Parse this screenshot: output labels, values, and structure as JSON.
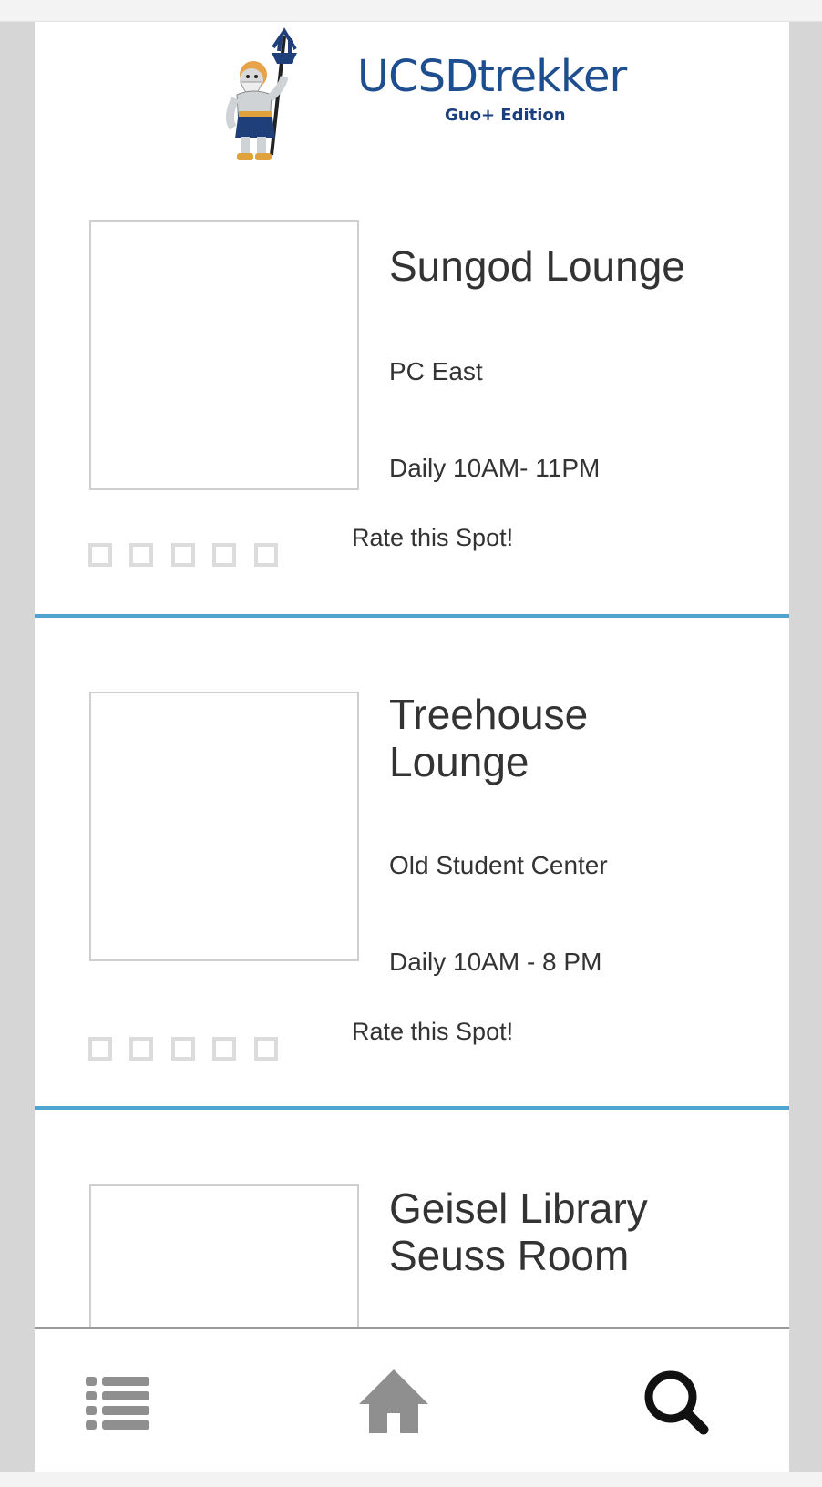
{
  "header": {
    "logo_title": "UCSDtrekker",
    "logo_subtitle": "Guo+ Edition",
    "brand_color": "#1f4e8f",
    "accent_color": "#4ea3cf"
  },
  "spots": [
    {
      "title": "Sungod Lounge",
      "location": "PC East",
      "hours": "Daily 10AM- 11PM",
      "rate_label": "Rate this Spot!",
      "rating": 0,
      "max_rating": 5
    },
    {
      "title": "Treehouse Lounge",
      "location": "Old Student Center",
      "hours": "Daily 10AM - 8 PM",
      "rate_label": "Rate this Spot!",
      "rating": 0,
      "max_rating": 5
    },
    {
      "title": "Geisel Library Seuss Room",
      "location": "",
      "hours": "",
      "rate_label": "",
      "rating": 0,
      "max_rating": 5
    }
  ],
  "bottom_nav": {
    "items": [
      {
        "icon": "list-icon",
        "active": false
      },
      {
        "icon": "home-icon",
        "active": false
      },
      {
        "icon": "search-icon",
        "active": true
      }
    ]
  }
}
